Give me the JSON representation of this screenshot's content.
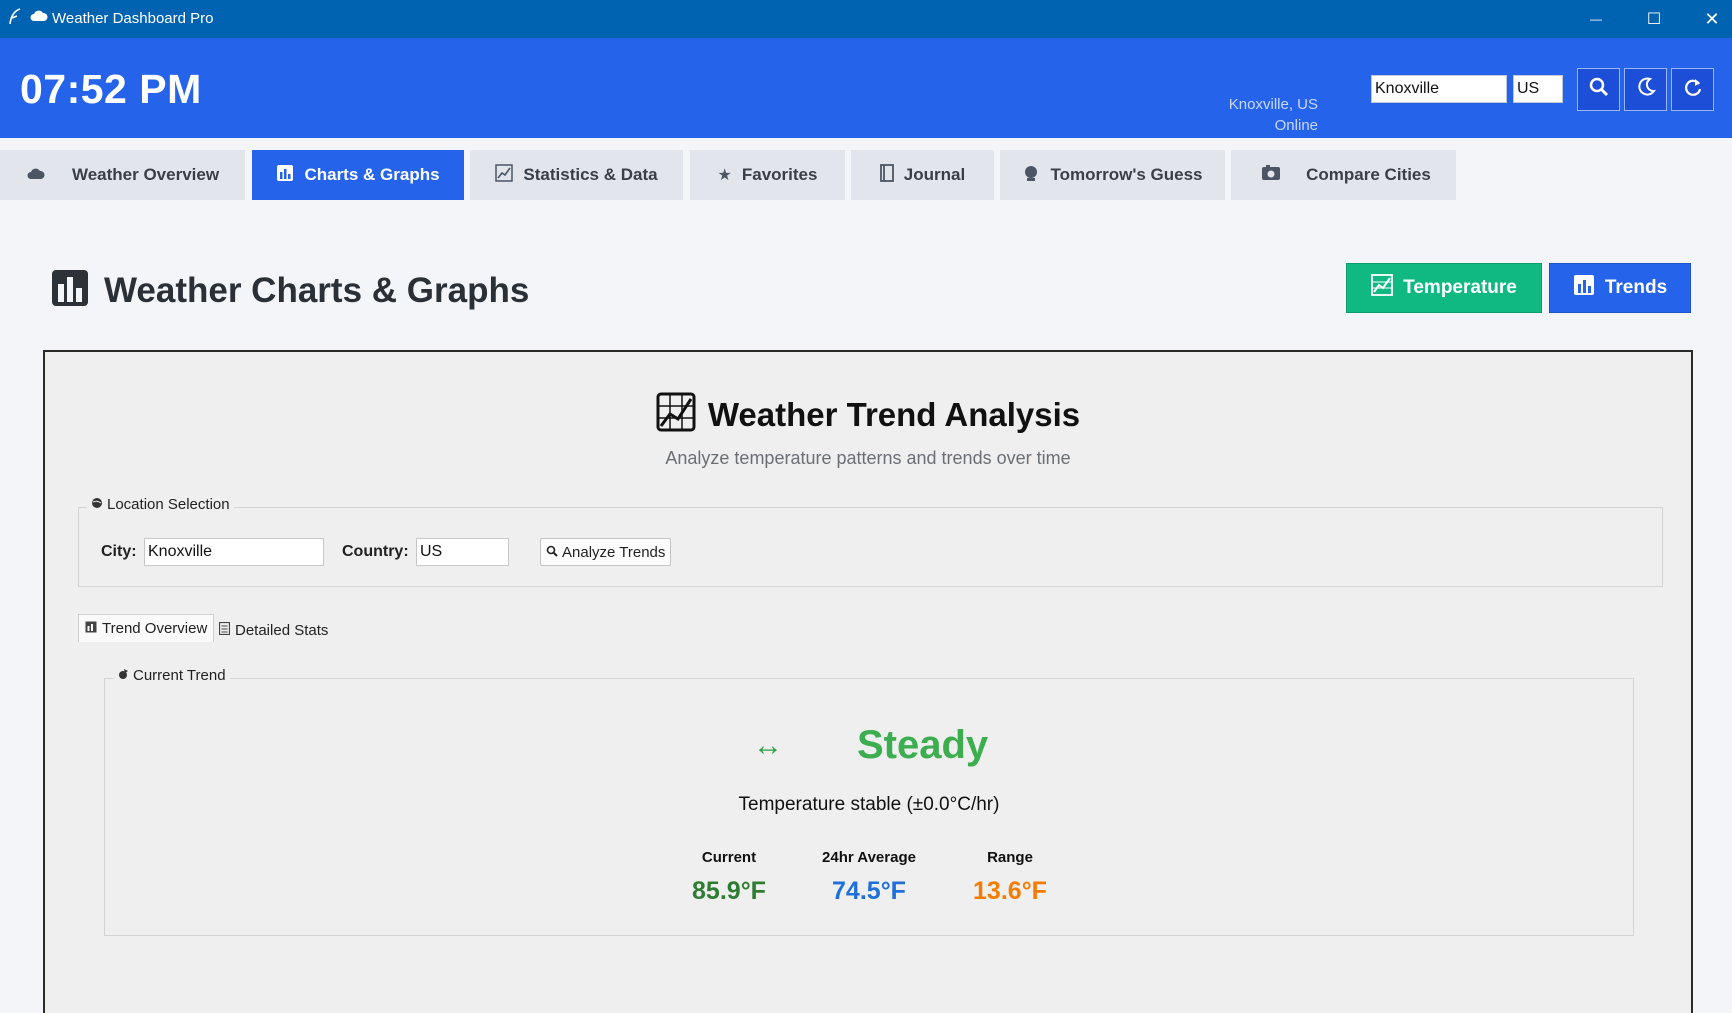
{
  "window": {
    "title": "Weather Dashboard Pro",
    "minimize_glyph": "—",
    "maximize_glyph": "☐",
    "close_glyph": "✕"
  },
  "header": {
    "time": "07:52 PM",
    "location": "Knoxville, US",
    "status": "Online",
    "city_input": "Knoxville",
    "country_input": "US",
    "buttons": [
      "search-icon",
      "theme-moon-icon",
      "refresh-icon"
    ]
  },
  "tabs": [
    {
      "label": "Weather Overview",
      "icon": "cloud-icon",
      "active": false
    },
    {
      "label": "Charts & Graphs",
      "icon": "chart-icon",
      "active": true
    },
    {
      "label": "Statistics & Data",
      "icon": "line-chart-icon",
      "active": false
    },
    {
      "label": "Favorites",
      "icon": "star-icon",
      "active": false
    },
    {
      "label": "Journal",
      "icon": "journal-icon",
      "active": false
    },
    {
      "label": "Tomorrow's Guess",
      "icon": "crystal-ball-icon",
      "active": false
    },
    {
      "label": "Compare Cities",
      "icon": "compare-icon",
      "active": false
    }
  ],
  "page": {
    "title": "Weather Charts & Graphs",
    "temperature_button": "Temperature",
    "trends_button": "Trends"
  },
  "colors": {
    "header_blue": "#2563eb",
    "titlebar_blue": "#0063b1",
    "temperature_green": "#10b981",
    "trends_blue": "#2563eb",
    "steady_green": "#3cae4f",
    "current_green": "#2e7d32",
    "avg_blue": "#1e6fd9",
    "range_orange": "#f57c00"
  },
  "analysis": {
    "title": "Weather Trend Analysis",
    "subtitle": "Analyze temperature patterns and trends over time",
    "location_group": "Location Selection",
    "city_label": "City:",
    "city_value": "Knoxville",
    "country_label": "Country:",
    "country_value": "US",
    "analyze_button": "Analyze Trends",
    "subtabs": [
      "Trend Overview",
      "Detailed Stats"
    ],
    "current_trend_group": "Current Trend",
    "trend_arrow": "↔",
    "trend_word": "Steady",
    "trend_description": "Temperature stable (±0.0°C/hr)",
    "stats": [
      {
        "label": "Current",
        "value": "85.9°F"
      },
      {
        "label": "24hr Average",
        "value": "74.5°F"
      },
      {
        "label": "Range",
        "value": "13.6°F"
      }
    ]
  }
}
